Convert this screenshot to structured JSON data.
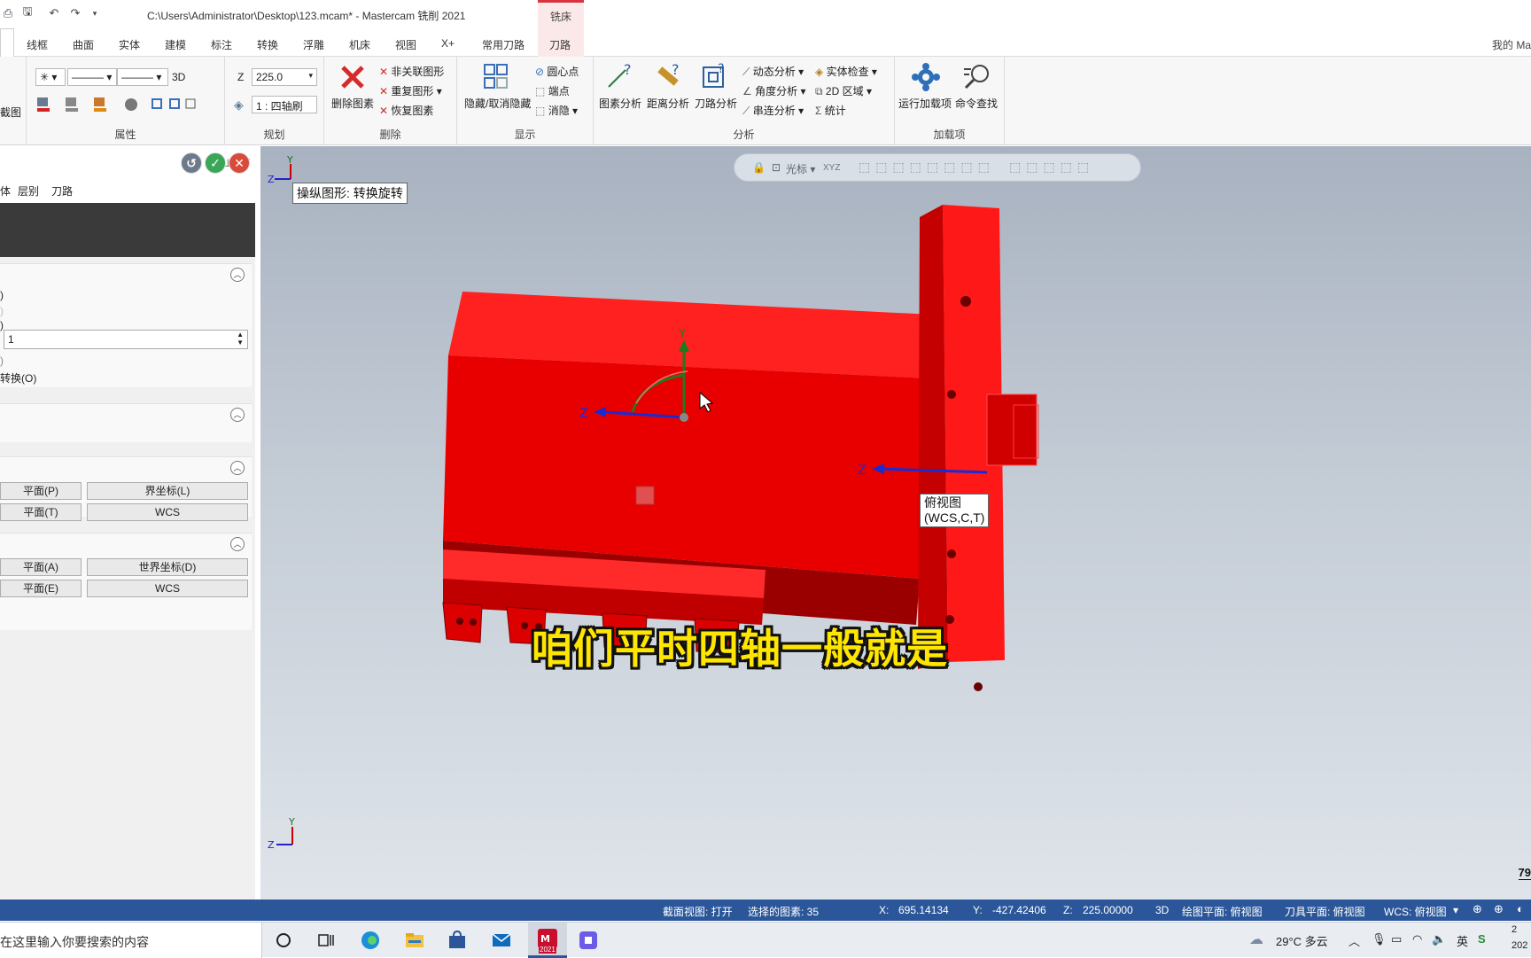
{
  "window": {
    "title": "C:\\Users\\Administrator\\Desktop\\123.mcam* - Mastercam 铣削 2021",
    "context_tab_group": "铣床"
  },
  "tabs": [
    "线框",
    "曲面",
    "实体",
    "建模",
    "标注",
    "转换",
    "浮雕",
    "机床",
    "视图",
    "X+",
    "常用刀路",
    "刀路"
  ],
  "user_label": "我的 Ma",
  "ribbon": {
    "clip_label": "截图",
    "attributes": {
      "label": "属性",
      "threed": "3D"
    },
    "planning": {
      "label": "规划",
      "z_label": "Z",
      "z_value": "225.0",
      "level_value": "1 : 四轴刷"
    },
    "delete": {
      "label": "删除",
      "delete_btn": "删除图素",
      "unassoc": "非关联图形",
      "dup": "重复图形",
      "restore": "恢复图素"
    },
    "display": {
      "label": "显示",
      "hide": "隐藏/取消隐藏",
      "center": "圆心点",
      "endpoints": "端点",
      "blank": "消隐"
    },
    "analysis": {
      "label": "分析",
      "entity": "图素分析",
      "distance": "距离分析",
      "toolpath": "刀路分析",
      "dynamic": "动态分析",
      "angle": "角度分析",
      "chain": "串连分析",
      "solid_check": "实体检查",
      "area2d": "2D 区域",
      "stats": "统计"
    },
    "addins": {
      "label": "加载项",
      "run": "运行加载项",
      "find": "命令查找"
    }
  },
  "panel": {
    "tabs": [
      "体",
      "层别",
      "刀路"
    ],
    "row1": ")",
    "row2": ")",
    "spinner_value": "1",
    "convert": "转换(O)",
    "plane_p": "平面(P)",
    "screen_coord": "界坐标(L)",
    "plane_t": "平面(T)",
    "wcs1": "WCS",
    "plane_a": "平面(A)",
    "world_coord": "世界坐标(D)",
    "plane_e": "平面(E)",
    "wcs2": "WCS"
  },
  "viewport": {
    "manip_label": "操纵图形: 转换旋转",
    "view_tip_line1": "俯视图",
    "view_tip_line2": "(WCS,C,T)",
    "toolbar_cursor": "光标",
    "axis_y": "Y",
    "axis_z": "Z",
    "xyz": "XYZ",
    "corner_num": "79"
  },
  "subtitle": "咱们平时四轴一般就是",
  "status": {
    "section_view": "截面视图: 打开",
    "selected": "选择的图素: 35",
    "x_label": "X:",
    "x_value": "695.14134",
    "y_label": "Y:",
    "y_value": "-427.42406",
    "z_label": "Z:",
    "z_value": "225.00000",
    "mode": "3D",
    "cplane": "绘图平面: 俯视图",
    "tplane": "刀具平面: 俯视图",
    "wcs": "WCS: 俯视图"
  },
  "taskbar": {
    "search_text": "在这里输入你要搜索的内容",
    "weather": "29°C 多云",
    "ime": "英",
    "clock_line1": "2",
    "clock_line2": "202",
    "app_badge": "2021"
  },
  "colors": {
    "accent": "#2b579a",
    "model_red": "#e00000",
    "subtitle": "#ffe600"
  }
}
